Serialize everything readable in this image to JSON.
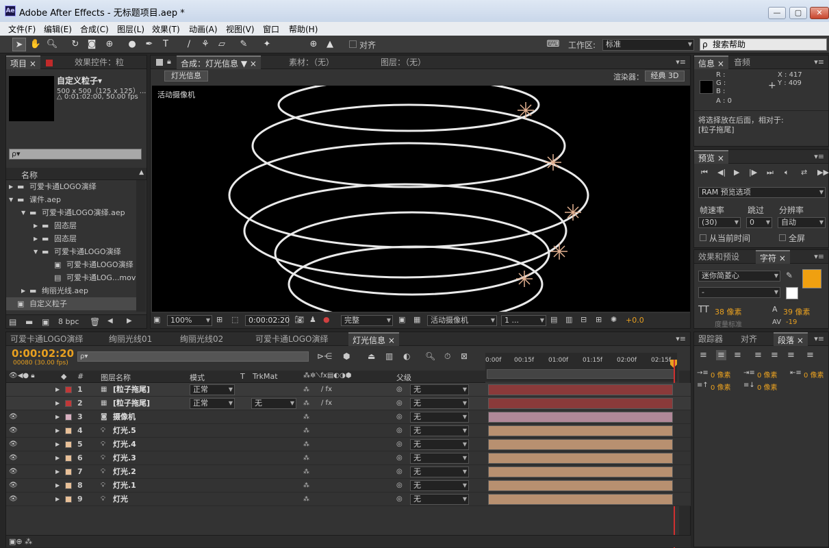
{
  "app": {
    "title": "Adobe After Effects - 无标题项目.aep *",
    "logo": "Ae"
  },
  "window_buttons": [
    "—",
    "▢",
    "✕"
  ],
  "menu": [
    "文件(F)",
    "编辑(E)",
    "合成(C)",
    "图层(L)",
    "效果(T)",
    "动画(A)",
    "视图(V)",
    "窗口",
    "帮助(H)"
  ],
  "toolbar": {
    "align_label": "对齐",
    "workspace_label": "工作区:",
    "workspace_value": "标准",
    "search_placeholder": "搜索帮助"
  },
  "project": {
    "tabs": [
      "项目",
      "效果控件：粒"
    ],
    "item_name": "自定义粒子▾",
    "item_info1": "500 x 500（125 x 125）...",
    "item_info2": "△ 0:01:02:00, 50.00 fps",
    "search_placeholder": "ρ▾",
    "column_name": "名称",
    "items": [
      {
        "label": "可爱卡通LOGO演绎",
        "indent": 0,
        "type": "folder",
        "arrow": "▶"
      },
      {
        "label": "课件.aep",
        "indent": 0,
        "type": "folder",
        "arrow": "▼"
      },
      {
        "label": "可爱卡通LOGO演绎.aep",
        "indent": 1,
        "type": "folder",
        "arrow": "▼"
      },
      {
        "label": "固态层",
        "indent": 2,
        "type": "folder",
        "arrow": "▶"
      },
      {
        "label": "固态层",
        "indent": 2,
        "type": "folder",
        "arrow": "▶"
      },
      {
        "label": "可爱卡通LOGO演绎",
        "indent": 2,
        "type": "folder",
        "arrow": "▼"
      },
      {
        "label": "可爱卡通LOGO演绎",
        "indent": 3,
        "type": "comp",
        "arrow": ""
      },
      {
        "label": "可爱卡通LOG...mov",
        "indent": 3,
        "type": "file",
        "arrow": ""
      },
      {
        "label": "绚丽光线.aep",
        "indent": 1,
        "type": "folder",
        "arrow": "▶"
      },
      {
        "label": "自定义粒子",
        "indent": 0,
        "type": "comp",
        "arrow": "",
        "selected": true
      }
    ],
    "bpc": "8 bpc"
  },
  "composition": {
    "tabs": [
      "合成：灯光信息",
      "素材：（无）",
      "图层：（无）"
    ],
    "comp_button": "灯光信息",
    "renderer_label": "渲染器：",
    "renderer_value": "经典 3D",
    "camera_label": "活动摄像机",
    "zoom": "100%",
    "timecode": "0:00:02:20",
    "resolution": "完整",
    "view": "活动摄像机",
    "views": "1 ...",
    "exposure": "+0.0"
  },
  "info": {
    "tabs": [
      "信息",
      "音频"
    ],
    "r": "R :",
    "g": "G :",
    "b": "B :",
    "a": "A : 0",
    "x": "X : 417",
    "y": "Y : 409",
    "message1": "将选择放在后面，相对于:",
    "message2": "[粒子拖尾]"
  },
  "preview": {
    "tab": "预览",
    "ram": "RAM 预览选项",
    "fps_label": "帧速率",
    "skip_label": "跳过",
    "res_label": "分辨率",
    "fps_value": "(30)",
    "skip_value": "0",
    "res_value": "自动",
    "from_current": "从当前时间",
    "fullscreen": "全屏"
  },
  "character": {
    "tabs": [
      "效果和预设",
      "字符"
    ],
    "font": "迷你简菱心",
    "style": "-",
    "size": "38 像素",
    "leading": "39 像素",
    "tracking_label": "度量标准",
    "tracking_value": "-19",
    "fill_color": "#f0a010"
  },
  "paragraph": {
    "tabs": [
      "跟踪器",
      "对齐",
      "段落"
    ],
    "indent1": "0 像素",
    "indent2": "0 像素",
    "indent3": "0 像素",
    "space1": "0 像素",
    "space2": "0 像素"
  },
  "timeline": {
    "tabs": [
      "可爱卡通LOGO演绎",
      "绚丽光线01",
      "绚丽光线02",
      "可爱卡通LOGO演绎",
      "灯光信息"
    ],
    "timecode": "0:00:02:20",
    "frame_info": "00080 (30.00 fps)",
    "ruler": [
      "0:00f",
      "00:15f",
      "01:00f",
      "01:15f",
      "02:00f",
      "02:15f"
    ],
    "col_num": "#",
    "col_name": "图层名称",
    "col_mode": "模式",
    "col_t": "T",
    "col_trkmat": "TrkMat",
    "col_parent": "父级",
    "layers": [
      {
        "num": "1",
        "name": "[粒子拖尾]",
        "color": "#c03838",
        "mode": "正常",
        "trkmat": "",
        "parent": "无",
        "bar": "#8a3a3a"
      },
      {
        "num": "2",
        "name": "[粒子拖尾]",
        "color": "#c03838",
        "mode": "正常",
        "trkmat": "无",
        "parent": "无",
        "bar": "#8a3a3a"
      },
      {
        "num": "3",
        "name": "摄像机",
        "color": "#d8b0c0",
        "mode": "",
        "trkmat": "",
        "parent": "无",
        "bar": "#b08898"
      },
      {
        "num": "4",
        "name": "灯光.5",
        "color": "#e8c098",
        "mode": "",
        "trkmat": "",
        "parent": "无",
        "bar": "#b89070"
      },
      {
        "num": "5",
        "name": "灯光.4",
        "color": "#e8c098",
        "mode": "",
        "trkmat": "",
        "parent": "无",
        "bar": "#b89070"
      },
      {
        "num": "6",
        "name": "灯光.3",
        "color": "#e8c098",
        "mode": "",
        "trkmat": "",
        "parent": "无",
        "bar": "#b89070"
      },
      {
        "num": "7",
        "name": "灯光.2",
        "color": "#e8c098",
        "mode": "",
        "trkmat": "",
        "parent": "无",
        "bar": "#b89070"
      },
      {
        "num": "8",
        "name": "灯光.1",
        "color": "#e8c098",
        "mode": "",
        "trkmat": "",
        "parent": "无",
        "bar": "#b89070"
      },
      {
        "num": "9",
        "name": "灯光",
        "color": "#e8c098",
        "mode": "",
        "trkmat": "",
        "parent": "无",
        "bar": "#b89070"
      }
    ]
  },
  "colors": {
    "accent": "#f0a010",
    "timecode": "#e8a020",
    "playhead": "#d03030"
  }
}
